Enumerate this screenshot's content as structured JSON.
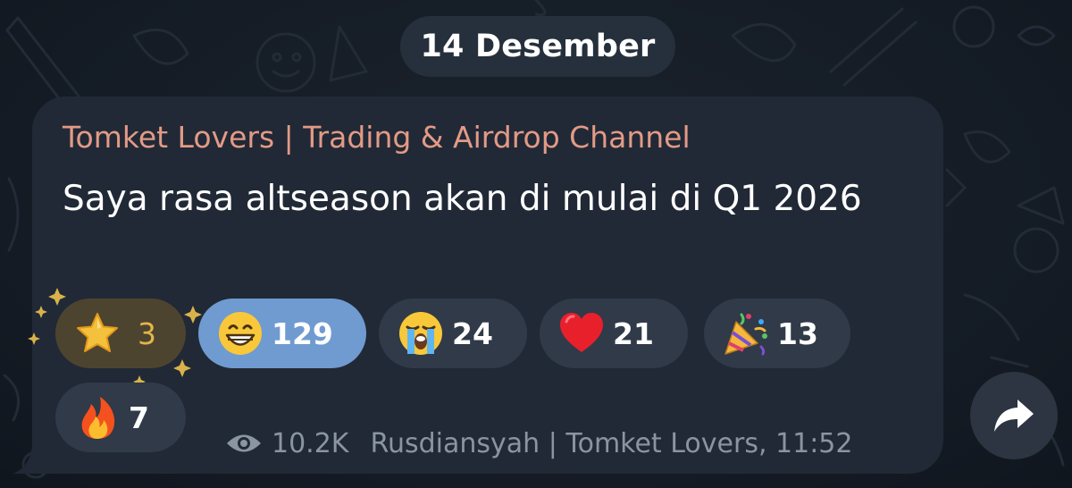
{
  "date_separator": "14 Desember",
  "message": {
    "channel_name": "Tomket Lovers | Trading & Airdrop Channel",
    "text": "Saya rasa altseason akan di mulai di Q1 2026",
    "reactions": [
      {
        "emoji": "star-icon",
        "count": "3",
        "paid": true
      },
      {
        "emoji": "grinning-face-icon",
        "count": "129",
        "selected": true
      },
      {
        "emoji": "loudly-crying-face-icon",
        "count": "24"
      },
      {
        "emoji": "red-heart-icon",
        "count": "21"
      },
      {
        "emoji": "party-popper-icon",
        "count": "13"
      },
      {
        "emoji": "fire-icon",
        "count": "7"
      }
    ],
    "views": "10.2K",
    "signature_time": "Rusdiansyah | Tomket Lovers, 11:52"
  },
  "colors": {
    "bubble": "#212936",
    "channel_name": "#e39a86",
    "reaction_pill": "#303a48",
    "selected_reaction": "#6f9bd0",
    "meta_text": "#8b94a1"
  }
}
